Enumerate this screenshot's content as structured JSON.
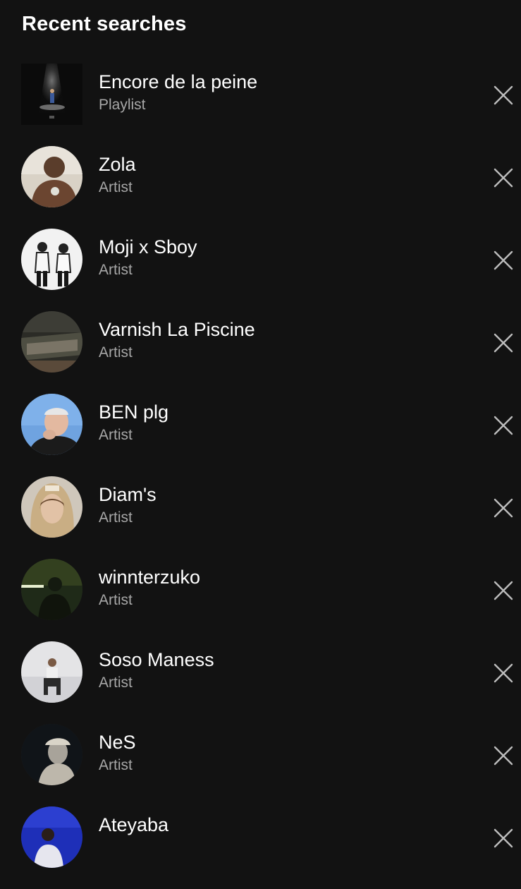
{
  "header": {
    "title": "Recent searches"
  },
  "colors": {
    "background": "#121212",
    "primary_text": "#ffffff",
    "secondary_text": "#a7a7a7"
  },
  "icons": {
    "remove": "close-icon"
  },
  "items": [
    {
      "name": "Encore de la peine",
      "type": "Playlist"
    },
    {
      "name": "Zola",
      "type": "Artist"
    },
    {
      "name": "Moji x Sboy",
      "type": "Artist"
    },
    {
      "name": "Varnish La Piscine",
      "type": "Artist"
    },
    {
      "name": "BEN plg",
      "type": "Artist"
    },
    {
      "name": "Diam's",
      "type": "Artist"
    },
    {
      "name": "winnterzuko",
      "type": "Artist"
    },
    {
      "name": "Soso Maness",
      "type": "Artist"
    },
    {
      "name": "NeS",
      "type": "Artist"
    },
    {
      "name": "Ateyaba",
      "type": ""
    }
  ]
}
